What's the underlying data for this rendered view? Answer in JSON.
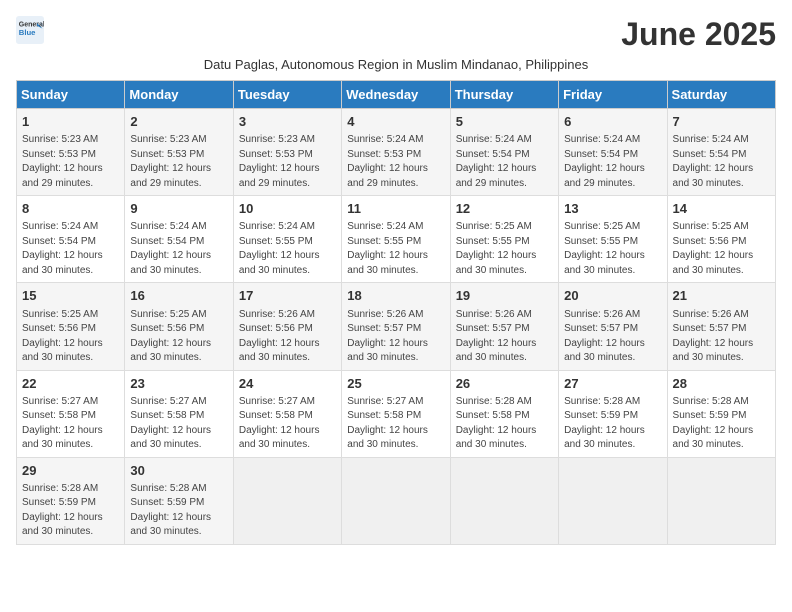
{
  "logo": {
    "line1": "General",
    "line2": "Blue"
  },
  "month_title": "June 2025",
  "subtitle": "Datu Paglas, Autonomous Region in Muslim Mindanao, Philippines",
  "days_of_week": [
    "Sunday",
    "Monday",
    "Tuesday",
    "Wednesday",
    "Thursday",
    "Friday",
    "Saturday"
  ],
  "weeks": [
    [
      {
        "day": 1,
        "sunrise": "5:23 AM",
        "sunset": "5:53 PM",
        "daylight": "12 hours and 29 minutes."
      },
      {
        "day": 2,
        "sunrise": "5:23 AM",
        "sunset": "5:53 PM",
        "daylight": "12 hours and 29 minutes."
      },
      {
        "day": 3,
        "sunrise": "5:23 AM",
        "sunset": "5:53 PM",
        "daylight": "12 hours and 29 minutes."
      },
      {
        "day": 4,
        "sunrise": "5:24 AM",
        "sunset": "5:53 PM",
        "daylight": "12 hours and 29 minutes."
      },
      {
        "day": 5,
        "sunrise": "5:24 AM",
        "sunset": "5:54 PM",
        "daylight": "12 hours and 29 minutes."
      },
      {
        "day": 6,
        "sunrise": "5:24 AM",
        "sunset": "5:54 PM",
        "daylight": "12 hours and 29 minutes."
      },
      {
        "day": 7,
        "sunrise": "5:24 AM",
        "sunset": "5:54 PM",
        "daylight": "12 hours and 30 minutes."
      }
    ],
    [
      {
        "day": 8,
        "sunrise": "5:24 AM",
        "sunset": "5:54 PM",
        "daylight": "12 hours and 30 minutes."
      },
      {
        "day": 9,
        "sunrise": "5:24 AM",
        "sunset": "5:54 PM",
        "daylight": "12 hours and 30 minutes."
      },
      {
        "day": 10,
        "sunrise": "5:24 AM",
        "sunset": "5:55 PM",
        "daylight": "12 hours and 30 minutes."
      },
      {
        "day": 11,
        "sunrise": "5:24 AM",
        "sunset": "5:55 PM",
        "daylight": "12 hours and 30 minutes."
      },
      {
        "day": 12,
        "sunrise": "5:25 AM",
        "sunset": "5:55 PM",
        "daylight": "12 hours and 30 minutes."
      },
      {
        "day": 13,
        "sunrise": "5:25 AM",
        "sunset": "5:55 PM",
        "daylight": "12 hours and 30 minutes."
      },
      {
        "day": 14,
        "sunrise": "5:25 AM",
        "sunset": "5:56 PM",
        "daylight": "12 hours and 30 minutes."
      }
    ],
    [
      {
        "day": 15,
        "sunrise": "5:25 AM",
        "sunset": "5:56 PM",
        "daylight": "12 hours and 30 minutes."
      },
      {
        "day": 16,
        "sunrise": "5:25 AM",
        "sunset": "5:56 PM",
        "daylight": "12 hours and 30 minutes."
      },
      {
        "day": 17,
        "sunrise": "5:26 AM",
        "sunset": "5:56 PM",
        "daylight": "12 hours and 30 minutes."
      },
      {
        "day": 18,
        "sunrise": "5:26 AM",
        "sunset": "5:57 PM",
        "daylight": "12 hours and 30 minutes."
      },
      {
        "day": 19,
        "sunrise": "5:26 AM",
        "sunset": "5:57 PM",
        "daylight": "12 hours and 30 minutes."
      },
      {
        "day": 20,
        "sunrise": "5:26 AM",
        "sunset": "5:57 PM",
        "daylight": "12 hours and 30 minutes."
      },
      {
        "day": 21,
        "sunrise": "5:26 AM",
        "sunset": "5:57 PM",
        "daylight": "12 hours and 30 minutes."
      }
    ],
    [
      {
        "day": 22,
        "sunrise": "5:27 AM",
        "sunset": "5:58 PM",
        "daylight": "12 hours and 30 minutes."
      },
      {
        "day": 23,
        "sunrise": "5:27 AM",
        "sunset": "5:58 PM",
        "daylight": "12 hours and 30 minutes."
      },
      {
        "day": 24,
        "sunrise": "5:27 AM",
        "sunset": "5:58 PM",
        "daylight": "12 hours and 30 minutes."
      },
      {
        "day": 25,
        "sunrise": "5:27 AM",
        "sunset": "5:58 PM",
        "daylight": "12 hours and 30 minutes."
      },
      {
        "day": 26,
        "sunrise": "5:28 AM",
        "sunset": "5:58 PM",
        "daylight": "12 hours and 30 minutes."
      },
      {
        "day": 27,
        "sunrise": "5:28 AM",
        "sunset": "5:59 PM",
        "daylight": "12 hours and 30 minutes."
      },
      {
        "day": 28,
        "sunrise": "5:28 AM",
        "sunset": "5:59 PM",
        "daylight": "12 hours and 30 minutes."
      }
    ],
    [
      {
        "day": 29,
        "sunrise": "5:28 AM",
        "sunset": "5:59 PM",
        "daylight": "12 hours and 30 minutes."
      },
      {
        "day": 30,
        "sunrise": "5:28 AM",
        "sunset": "5:59 PM",
        "daylight": "12 hours and 30 minutes."
      },
      null,
      null,
      null,
      null,
      null
    ]
  ]
}
